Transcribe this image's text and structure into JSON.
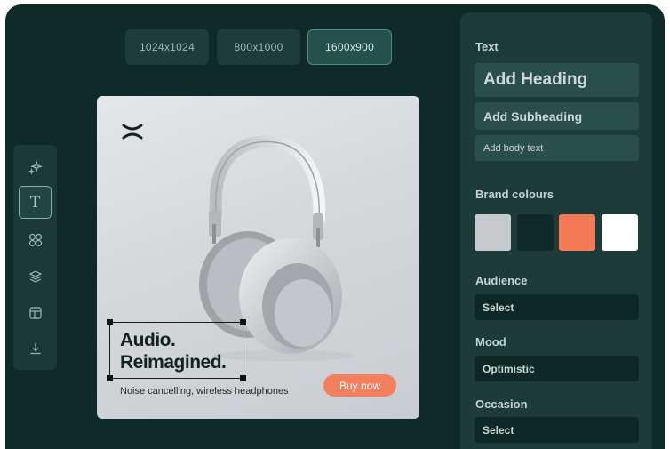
{
  "sizes": [
    {
      "label": "1024x1024"
    },
    {
      "label": "800x1000"
    },
    {
      "label": "1600x900"
    }
  ],
  "active_size": "1600x900",
  "toolbar": {
    "tools": [
      "sparkle-icon",
      "text-icon",
      "elements-icon",
      "layers-icon",
      "template-icon",
      "download-icon"
    ],
    "active_tool": "text-icon",
    "text_tool_glyph": "T"
  },
  "ad": {
    "headline_line1": "Audio.",
    "headline_line2": "Reimagined.",
    "tagline": "Noise cancelling, wireless headphones",
    "cta": "Buy now",
    "cta_color": "#f47f5e"
  },
  "panel": {
    "text_section": "Text",
    "add_heading": "Add Heading",
    "add_subheading": "Add Subheading",
    "add_body": "Add body text",
    "brand_colours_label": "Brand colours",
    "brand_colours": [
      "#c7c9cc",
      "#0f2a27",
      "#f47a55",
      "#ffffff"
    ],
    "audience_label": "Audience",
    "audience_value": "Select",
    "mood_label": "Mood",
    "mood_value": "Optimistic",
    "occasion_label": "Occasion",
    "occasion_value": "Select"
  }
}
